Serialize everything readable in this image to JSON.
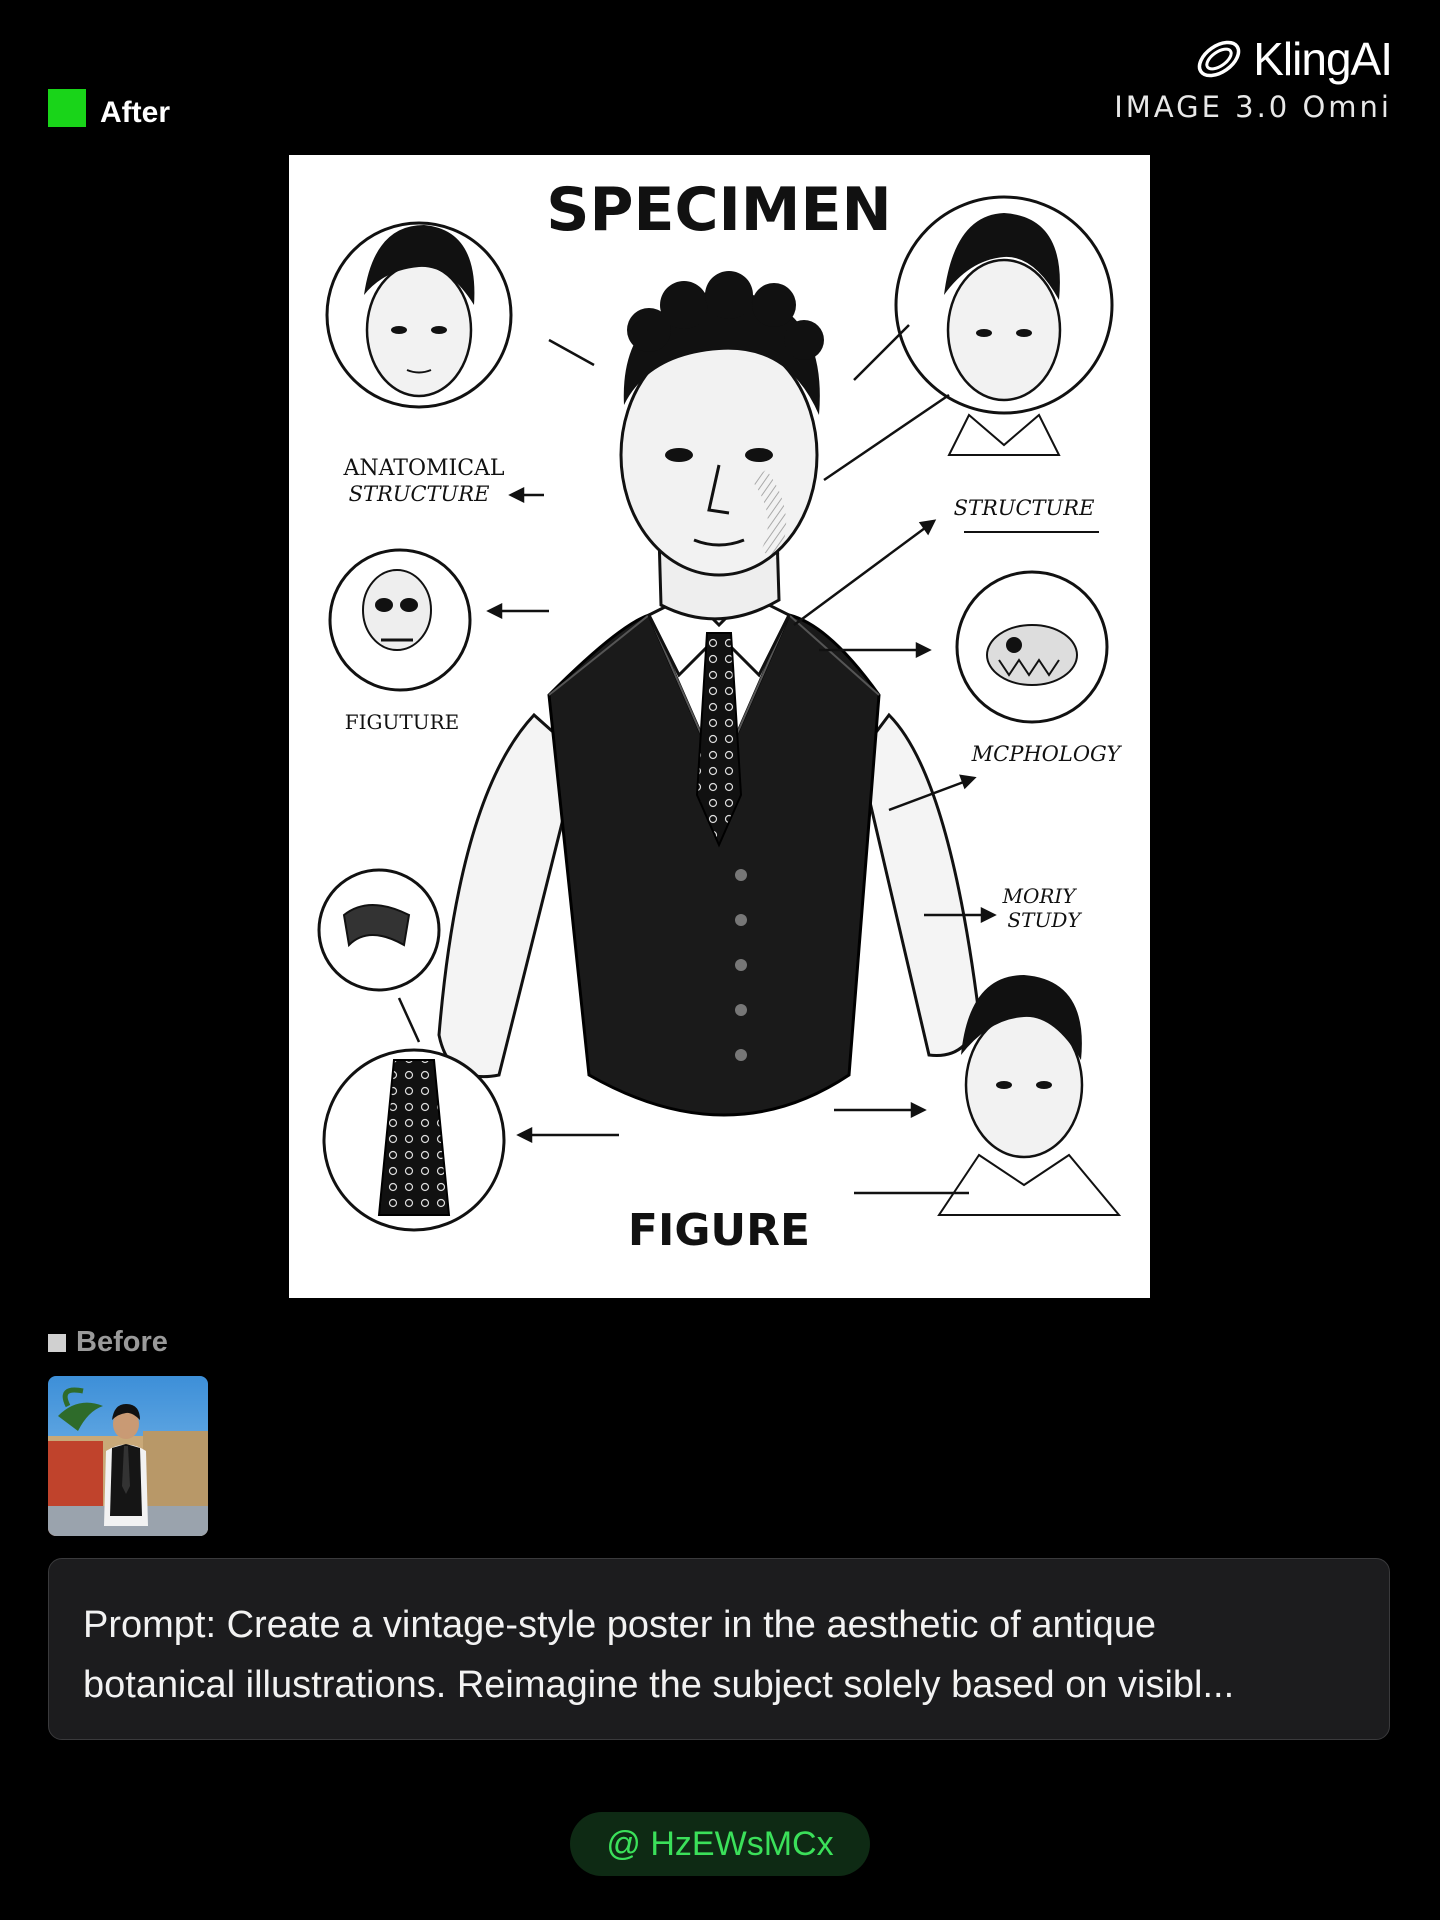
{
  "header": {
    "after_label": "After",
    "before_label": "Before",
    "brand_name": "KlingAI",
    "brand_subtitle": "IMAGE 3.0 Omni",
    "after_color": "#19d419"
  },
  "poster": {
    "title": "SPECIMEN",
    "bottom_title": "FIGURE",
    "labels": {
      "anatomical_1": "ANATOMICAL",
      "anatomical_2": "STRUCTURE",
      "structure": "STRUCTURE",
      "figure_small": "FIGUTURE",
      "morphology": "MCPHOLOGY",
      "study_1": "MORIY",
      "study_2": "STUDY"
    }
  },
  "prompt": {
    "line1": "Prompt: Create a vintage-style poster in the aesthetic of antique",
    "line2": "botanical illustrations. Reimagine the subject solely based on visibl..."
  },
  "handle": {
    "text": "@ HzEWsMCx",
    "color": "#3be05a"
  }
}
